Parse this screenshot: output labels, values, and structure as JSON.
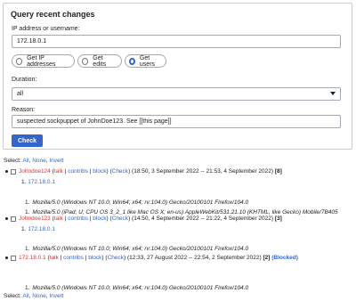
{
  "form": {
    "legend": "Query recent changes",
    "target_label": "IP address or username:",
    "target_value": "172.18.0.1",
    "radios": [
      {
        "label": "Get IP addresses",
        "checked": false
      },
      {
        "label": "Get edits",
        "checked": false
      },
      {
        "label": "Get users",
        "checked": true
      }
    ],
    "duration_label": "Duration:",
    "duration_value": "all",
    "reason_label": "Reason:",
    "reason_value": "suspected sockpuppet of JohnDoe123. See [[this page]]",
    "check_button": "Check"
  },
  "select_bar": {
    "prefix": "Select:",
    "all": "All",
    "sep1": ",",
    "none": "None",
    "sep2": ",",
    "invert": "Invert"
  },
  "results": [
    {
      "user": "Johndoe124",
      "talk": "talk",
      "contribs": "contribs",
      "block": "block",
      "check": "Check",
      "range": "(18:50, 3 September 2022 -- 21:53, 4 September 2022)",
      "count": "[8]",
      "ip_num": "1.",
      "ip": "172.18.0.1",
      "ua_num": "1.",
      "ua": "Mozilla/5.0 (Windows NT 10.0; Win64; x64; rv:104.0) Gecko/20100101 Firefox/104.0",
      "ua2_num": "1.",
      "ua2": "Mozilla/5.0 (iPad; U; CPU OS 3_2_1 like Mac OS X; en-us) AppleWebKit/531.21.10 (KHTML, like Gecko) Mobile/7B405"
    },
    {
      "user": "Johndoe123",
      "talk": "talk",
      "contribs": "contribs",
      "block": "block",
      "check": "Check",
      "range": "(14:50, 4 September 2022 -- 21:22, 4 September 2022)",
      "count": "[3]",
      "ip_num": "1.",
      "ip": "172.18.0.1",
      "ua_num": "1.",
      "ua": "Mozilla/5.0 (Windows NT 10.0; Win64; x64; rv:104.0) Gecko/20100101 Firefox/104.0"
    },
    {
      "user": "172.18.0.1",
      "talk": "talk",
      "contribs": "contribs",
      "block": "block",
      "check": "Check",
      "range": "(12:33, 27 August 2022 -- 22:54, 2 September 2022)",
      "count": "[2]",
      "blocked": "(Blocked)",
      "ua_num": "1.",
      "ua": "Mozilla/5.0 (Windows NT 10.0; Win64; x64; rv:104.0) Gecko/20100101 Firefox/104.0"
    }
  ]
}
